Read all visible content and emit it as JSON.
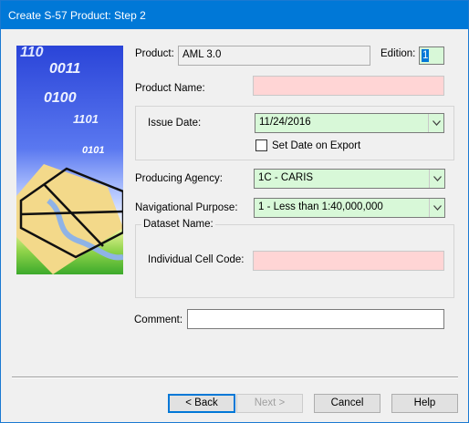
{
  "window": {
    "title": "Create S-57 Product: Step 2"
  },
  "form": {
    "product_label": "Product:",
    "product_value": "AML 3.0",
    "edition_label": "Edition:",
    "edition_value": "1",
    "product_name_label": "Product Name:",
    "product_name_value": "",
    "issue_date_label": "Issue Date:",
    "issue_date_value": "11/24/2016",
    "set_date_label": "Set Date on Export",
    "set_date_checked": false,
    "producing_agency_label": "Producing Agency:",
    "producing_agency_value": "1C - CARIS",
    "nav_purpose_label": "Navigational Purpose:",
    "nav_purpose_value": "1 - Less than 1:40,000,000",
    "dataset_name_label": "Dataset Name:",
    "cell_code_label": "Individual Cell Code:",
    "cell_code_value": "",
    "comment_label": "Comment:",
    "comment_value": ""
  },
  "image_text": {
    "b1": "110",
    "b2": "0011",
    "b3": "0100",
    "b4": "1101",
    "b5": "0101"
  },
  "buttons": {
    "back": "< Back",
    "next": "Next >",
    "cancel": "Cancel",
    "help": "Help"
  },
  "colors": {
    "required": "#ffd5d5",
    "valid": "#d8f8d8",
    "title_bar": "#0078d7"
  },
  "icons": {
    "dropdown": "chevron-down-icon",
    "wizard_image": "chart-wizard-image"
  }
}
